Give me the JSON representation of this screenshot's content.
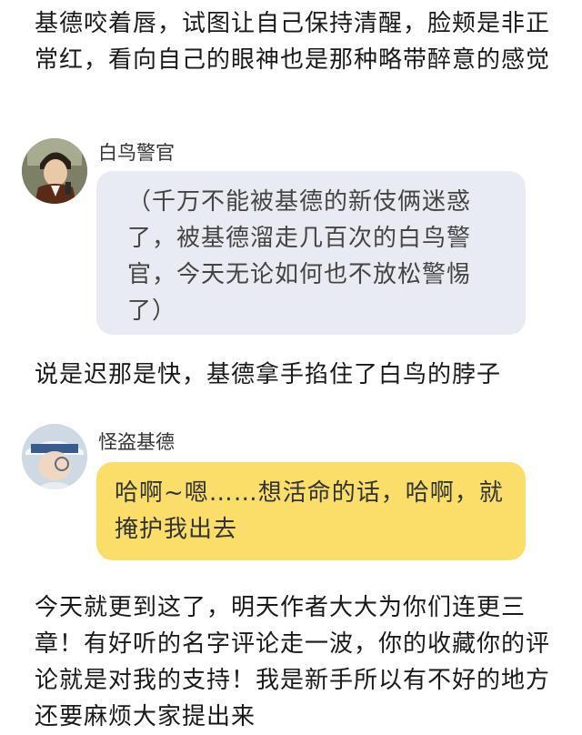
{
  "narration": {
    "intro": "基德咬着唇，试图让自己保持清醒，脸颊是非正常红，看向自己的眼神也是那种略带醉意的感觉",
    "middle": "说是迟那是快，基德拿手掐住了白鸟的脖子",
    "outro": "今天就更到这了，明天作者大大为你们连更三章！有好听的名字评论走一波，你的收藏你的评论就是对我的支持！我是新手所以有不好的地方还要麻烦大家提出来"
  },
  "messages": [
    {
      "sender": "白鸟警官",
      "text": "（千万不能被基德的新伎俩迷惑了，被基德溜走几百次的白鸟警官，今天无论如何也不放松警惕了）",
      "bubble_color": "#e8ebf2"
    },
    {
      "sender": "怪盗基德",
      "text": "哈啊~嗯……想活命的话，哈啊，就掩护我出去",
      "bubble_color": "#fbde6a"
    }
  ]
}
